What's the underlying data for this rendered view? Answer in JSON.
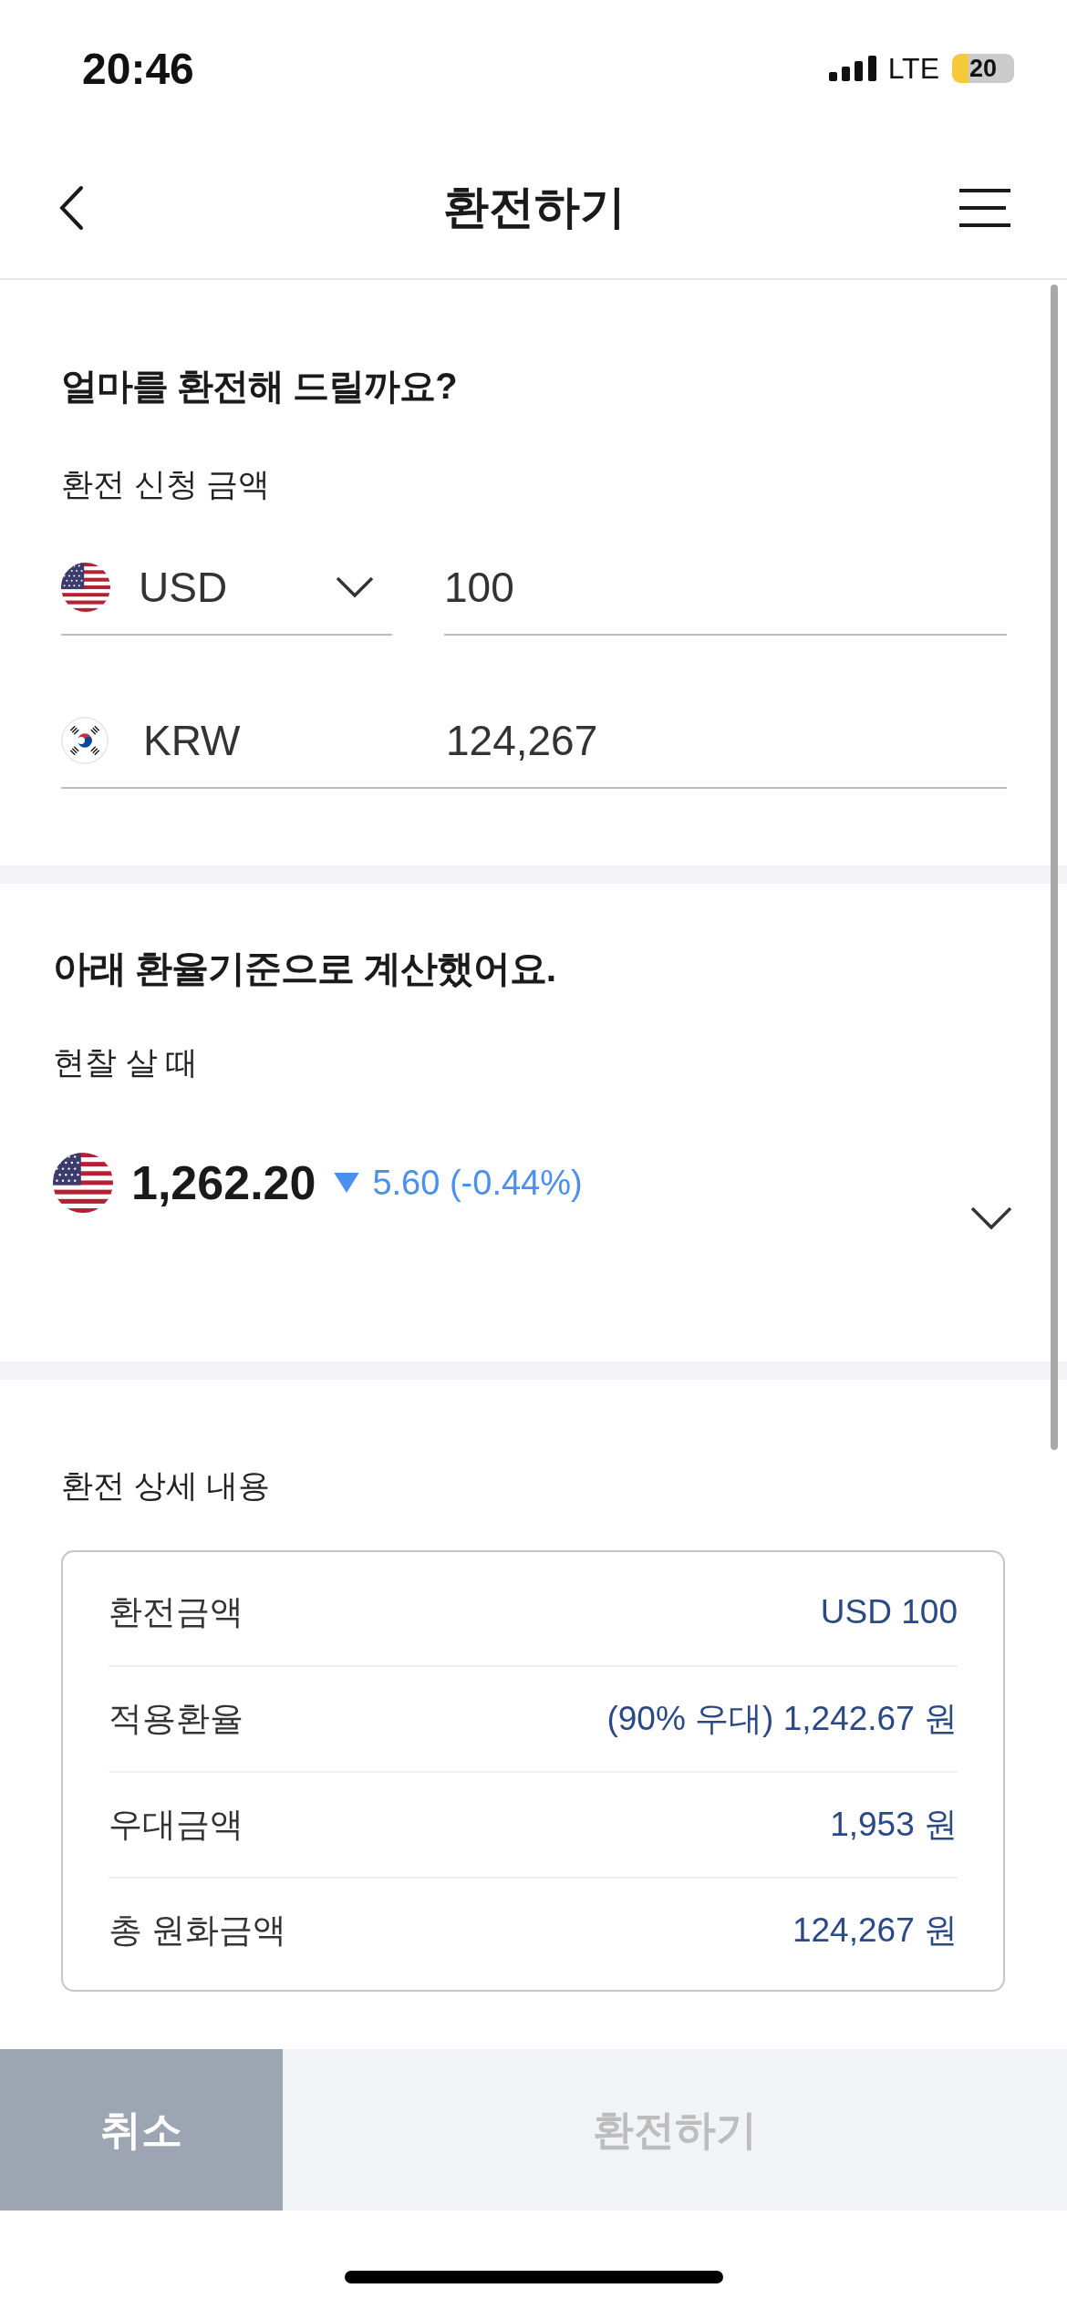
{
  "status_bar": {
    "time": "20:46",
    "network": "LTE",
    "battery": "20"
  },
  "header": {
    "title": "환전하기"
  },
  "amount_section": {
    "heading": "얼마를 환전해 드릴까요?",
    "label": "환전 신청 금액",
    "rows": [
      {
        "kind": "select",
        "currency": "USD",
        "amount": "100"
      },
      {
        "kind": "fixed",
        "currency": "KRW",
        "amount": "124,267"
      }
    ]
  },
  "rate_section": {
    "heading": "아래 환율기준으로 계산했어요.",
    "label": "현찰 살 때",
    "rate": "1,262.20",
    "falling": true,
    "change": "5.60 (-0.44%)",
    "expanded": false
  },
  "details": {
    "title": "환전 상세 내용",
    "rows": [
      {
        "label": "환전금액",
        "value": "USD 100"
      },
      {
        "label": "적용환율",
        "value": "(90% 우대) 1,242.67 원"
      },
      {
        "label": "우대금액",
        "value": "1,953 원"
      },
      {
        "label": "총 원화금액",
        "value": "124,267 원"
      }
    ]
  },
  "buttons": [
    {
      "kind": "cancel",
      "label": "취소",
      "disabled": false
    },
    {
      "kind": "confirm",
      "label": "환전하기",
      "disabled": true
    }
  ]
}
